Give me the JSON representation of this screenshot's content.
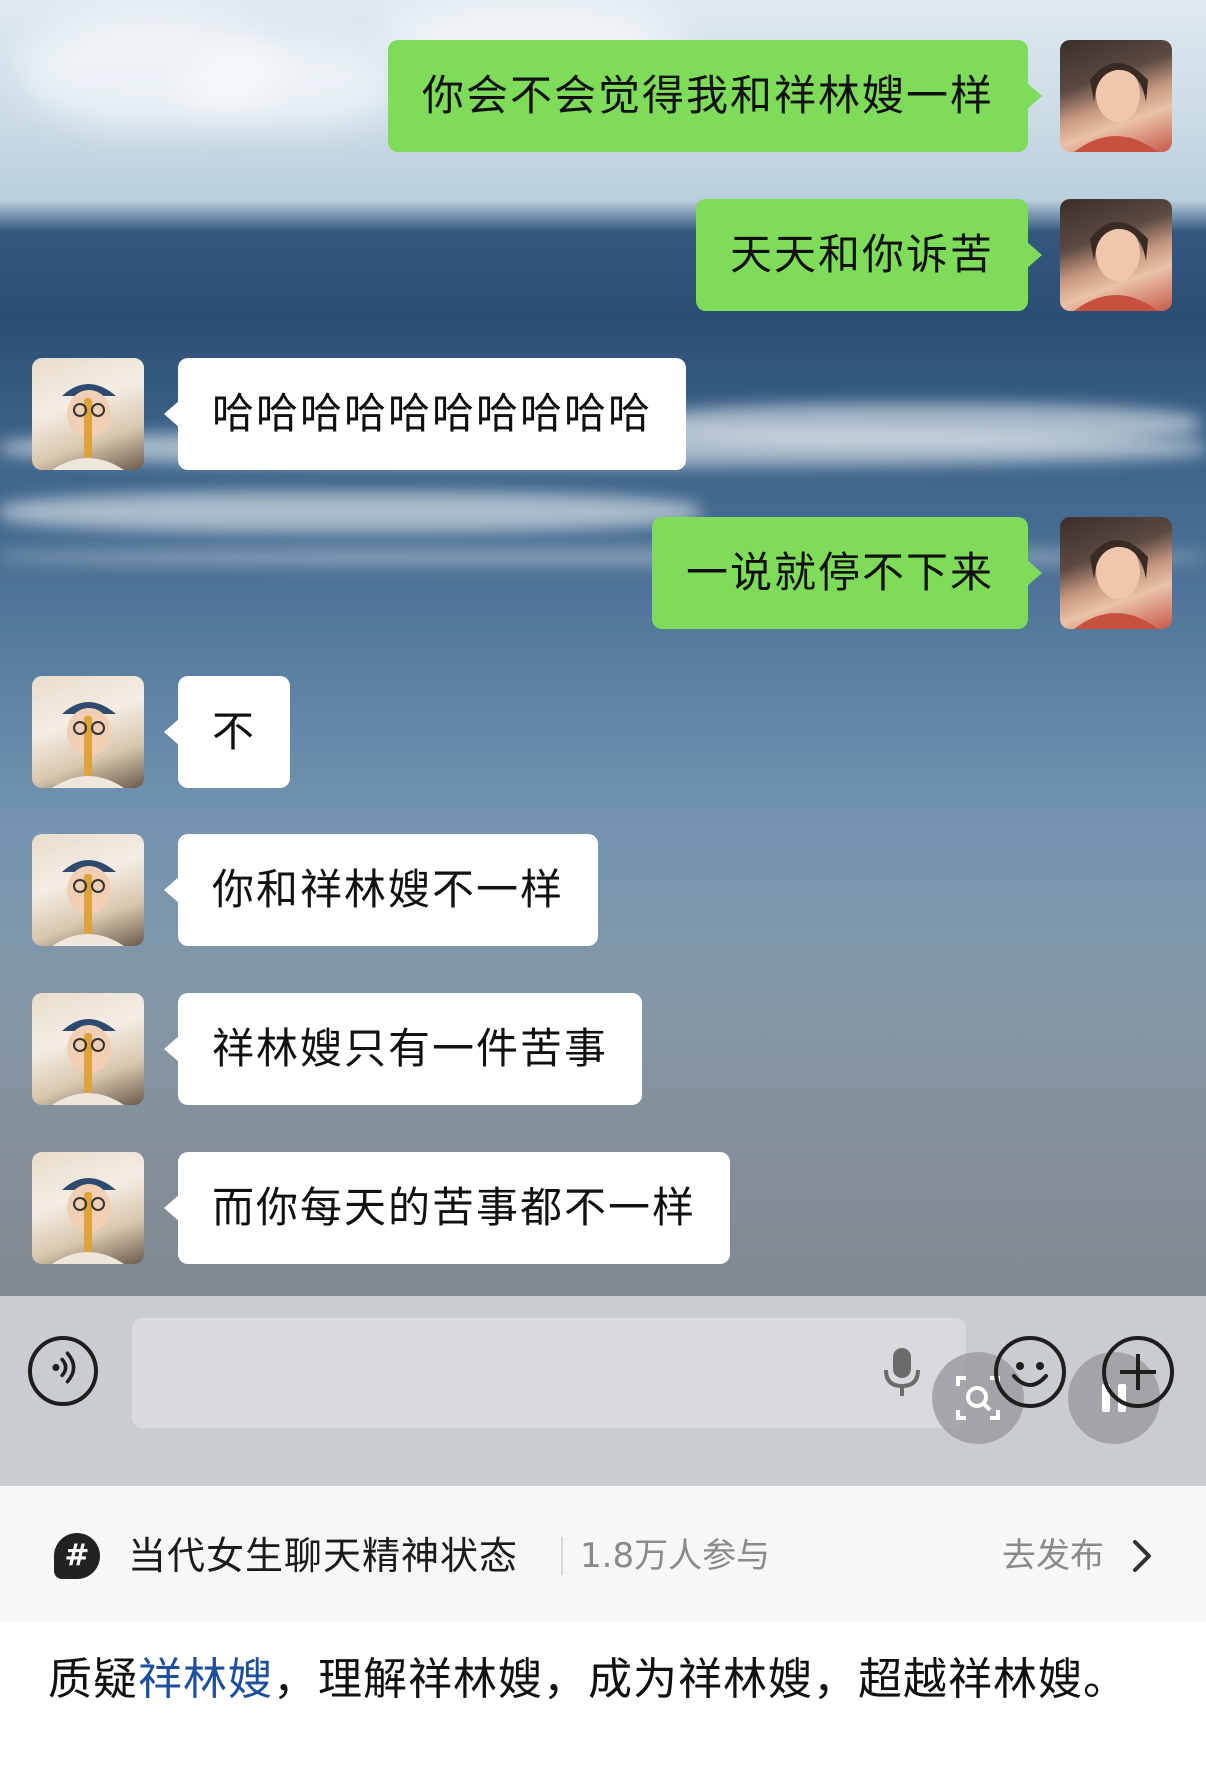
{
  "chat": {
    "messages": [
      {
        "sender": "me",
        "text": "你会不会觉得我和祥林嫂一样"
      },
      {
        "sender": "me",
        "text": "天天和你诉苦"
      },
      {
        "sender": "friend",
        "text": "哈哈哈哈哈哈哈哈哈哈"
      },
      {
        "sender": "me",
        "text": "一说就停不下来"
      },
      {
        "sender": "friend",
        "text": "不"
      },
      {
        "sender": "friend",
        "text": "你和祥林嫂不一样"
      },
      {
        "sender": "friend",
        "text": "祥林嫂只有一件苦事"
      },
      {
        "sender": "friend",
        "text": "而你每天的苦事都不一样"
      }
    ],
    "input_placeholder": ""
  },
  "icons": {
    "voice": "voice-mode-icon",
    "mic": "microphone-icon",
    "emoji": "emoji-icon",
    "plus": "plus-icon",
    "lens": "image-search-icon",
    "pause": "pause-icon",
    "topic": "hashtag-icon",
    "chevron": "chevron-right-icon"
  },
  "topic": {
    "icon_glyph": "#",
    "title": "当代女生聊天精神状态",
    "participants": "1.8万人参与",
    "action": "去发布"
  },
  "caption": {
    "prefix": "质疑",
    "link": "祥林嫂",
    "rest": "，理解祥林嫂，成为祥林嫂，超越祥林嫂。"
  },
  "colors": {
    "my_bubble": "#7fdc5a",
    "friend_bubble": "#ffffff",
    "link": "#1e4f9c"
  }
}
